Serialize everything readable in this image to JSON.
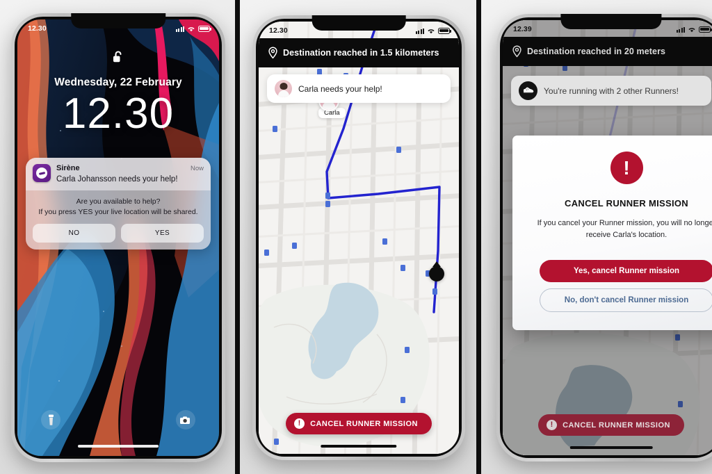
{
  "panels": [
    {
      "id": "lock-screen",
      "status": {
        "time": "12.30",
        "signal": "signal-bars",
        "wifi": "wifi-icon",
        "battery": "battery-icon"
      },
      "lock": {
        "icon": "unlock-icon",
        "date": "Wednesday, 22 February",
        "time": "12.30"
      },
      "notification": {
        "app": "Sirène",
        "time_ago": "Now",
        "message": "Carla Johansson needs your help!",
        "question_line1": "Are you available to help?",
        "question_line2": "If you press YES your live location will be shared.",
        "decline_label": "NO",
        "accept_label": "YES",
        "app_icon": "sirene-app-icon"
      },
      "bottom": {
        "left_icon": "flashlight-icon",
        "right_icon": "camera-icon"
      }
    },
    {
      "id": "runner-map",
      "status": {
        "time": "12.30"
      },
      "header": {
        "pin_icon": "location-pin-icon",
        "title": "Destination reached in 1.5 kilometers"
      },
      "chip": {
        "avatar": "carla-avatar",
        "text": "Carla needs your help!"
      },
      "marker": {
        "label": "Carla"
      },
      "cancel_button": {
        "icon": "exclamation-icon",
        "label": "CANCEL RUNNER MISSION"
      }
    },
    {
      "id": "cancel-modal",
      "status": {
        "time": "12.39"
      },
      "header": {
        "pin_icon": "location-pin-icon",
        "title": "Destination reached in 20 meters"
      },
      "chip": {
        "icon": "running-shoe-icon",
        "text": "You're running with 2 other Runners!"
      },
      "modal": {
        "close_icon": "close-icon",
        "warning_icon": "exclamation-icon",
        "warning_glyph": "!",
        "title": "CANCEL RUNNER MISSION",
        "body": "If you cancel your Runner mission, you will no longer receive Carla's location.",
        "confirm_label": "Yes, cancel Runner mission",
        "dismiss_label": "No, don't cancel Runner mission"
      },
      "cancel_button": {
        "icon": "exclamation-icon",
        "label": "CANCEL RUNNER MISSION"
      }
    }
  ],
  "colors": {
    "brand_red": "#b3122f",
    "route_blue": "#2323cf",
    "app_purple": "#5b1b84",
    "header_black": "#0b0b0b",
    "secondary_blue": "#4e6b93"
  }
}
